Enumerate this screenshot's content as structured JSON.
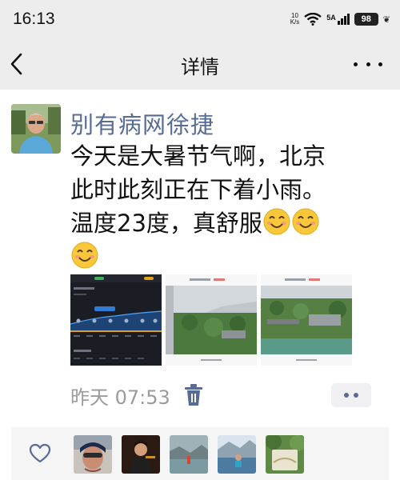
{
  "status_bar": {
    "time": "16:13",
    "net_speed_value": "10",
    "net_speed_unit": "K/s",
    "wifi_icon": "wifi-icon",
    "network_label": "5A",
    "battery_level": "98",
    "leaf_icon": "leaf-icon"
  },
  "nav": {
    "back_icon": "chevron-left-icon",
    "title": "详情",
    "more_icon": "more-dots-icon"
  },
  "post": {
    "username": "别有病网徐捷",
    "text_line1": "今天是大暑节气啊，北京",
    "text_line2": "此时此刻正在下着小雨。",
    "text_line3": "温度23度，真舒服",
    "emoji_icon": "smiling-face-emoji",
    "time": "昨天 07:53",
    "delete_icon": "trash-icon",
    "comment_icon": "comment-dots-icon",
    "photos": [
      "weather-app-screenshot",
      "rainy-city-view-1",
      "rainy-city-view-2"
    ]
  },
  "likes": {
    "heart_icon": "heart-outline-icon",
    "count": 5
  },
  "colors": {
    "username": "#576b95",
    "bar_bg": "#ededed",
    "time": "#9b9b9b",
    "likes_bg": "#f5f5f5"
  }
}
